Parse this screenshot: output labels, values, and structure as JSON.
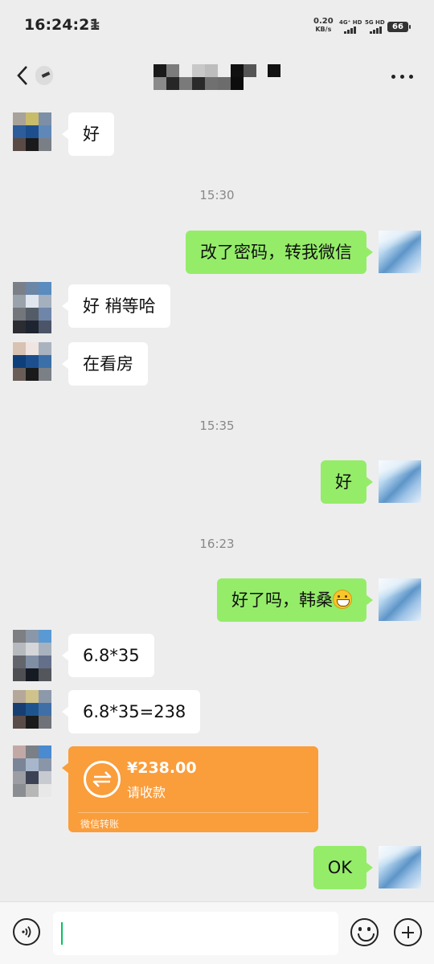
{
  "status_bar": {
    "time": "16:24:21",
    "net_speed_value": "0.20",
    "net_speed_unit": "KB/s",
    "network_1": "4G⁺ HD",
    "network_2": "5G HD",
    "battery": "66"
  },
  "header": {
    "back_icon": "chevron-left-icon",
    "more_icon": "more-horizontal-icon"
  },
  "messages": [
    {
      "side": "left",
      "text": "好"
    },
    {
      "timestamp": "15:30"
    },
    {
      "side": "right",
      "text": "改了密码，转我微信"
    },
    {
      "side": "left",
      "text": "好 稍等哈"
    },
    {
      "side": "left",
      "text": "在看房"
    },
    {
      "timestamp": "15:35"
    },
    {
      "side": "right",
      "text": "好"
    },
    {
      "timestamp": "16:23"
    },
    {
      "side": "right",
      "text": "好了吗，韩桑",
      "emoji": "grinning-face-icon"
    },
    {
      "side": "left",
      "text": "6.8*35"
    },
    {
      "side": "left",
      "text": "6.8*35=238"
    },
    {
      "side": "left",
      "type": "transfer",
      "amount": "¥238.00",
      "status": "请收款",
      "footer": "微信转账"
    },
    {
      "side": "right",
      "text": "OK"
    }
  ],
  "input_bar": {
    "voice_icon": "voice-icon",
    "emoji_icon": "smiley-icon",
    "plus_icon": "plus-circle-icon"
  },
  "colors": {
    "background": "#ededed",
    "bubble_self": "#95ec69",
    "bubble_other": "#ffffff",
    "transfer": "#fa9d3b",
    "cursor": "#07c160"
  }
}
